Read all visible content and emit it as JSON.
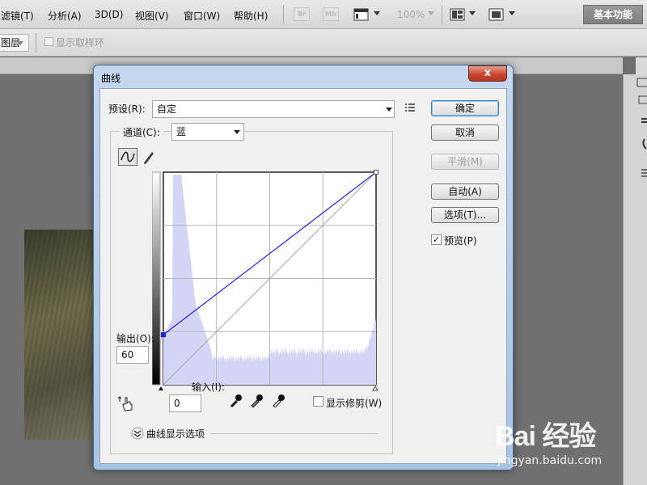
{
  "menubar": {
    "items": [
      "滤镜(T)",
      "分析(A)",
      "3D(D)",
      "视图(V)",
      "窗口(W)",
      "帮助(H)"
    ],
    "bridge_labels": [
      "Br",
      "Mb"
    ],
    "zoom": "100%",
    "workspace_label": "基本功能"
  },
  "optionsbar": {
    "layer_select_value": "图层",
    "show_ring_label": "显示取样环"
  },
  "dialog": {
    "title": "曲线",
    "close_label": "x",
    "preset_label": "预设(R):",
    "preset_value": "自定",
    "channel_label": "通道(C):",
    "channel_value": "蓝",
    "output_label": "输出(O):",
    "output_value": "60",
    "input_label": "输入(I):",
    "input_value": "0",
    "show_clipping_label": "显示修剪(W)",
    "show_clipping_checked": false,
    "curve_display_options_label": "曲线显示选项",
    "buttons": {
      "ok": "确定",
      "cancel": "取消",
      "smooth": "平滑(M)",
      "auto": "自动(A)",
      "options": "选项(T)..."
    },
    "preview_label": "预览(P)",
    "preview_checked": true
  },
  "chart_data": {
    "type": "line",
    "channel": "蓝",
    "xlim": [
      0,
      255
    ],
    "ylim": [
      0,
      255
    ],
    "grid": "4x4",
    "series": [
      {
        "points": [
          [
            0,
            60
          ],
          [
            255,
            255
          ]
        ]
      },
      {
        "points": [
          [
            0,
            0
          ],
          [
            255,
            255
          ]
        ]
      }
    ],
    "histogram_color": "#d4d4f4",
    "curve_color": "#2020e0",
    "baseline_color": "#a8a8a8"
  },
  "watermark": {
    "logo": "Bai 经验",
    "url": "jingyan.baidu.com"
  }
}
